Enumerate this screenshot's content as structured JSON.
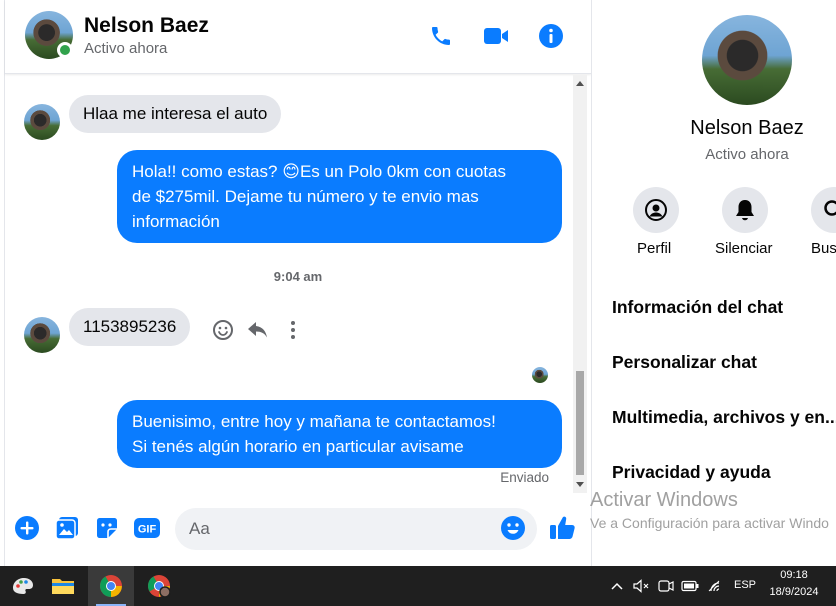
{
  "colors": {
    "accent": "#0a7cff",
    "online": "#31a24c",
    "incoming_bubble": "#e4e6eb",
    "outgoing_bubble": "#0a7cff"
  },
  "header": {
    "name": "Nelson Baez",
    "status": "Activo ahora",
    "icons": [
      "phone-icon",
      "video-icon",
      "info-icon"
    ]
  },
  "messages": [
    {
      "direction": "in",
      "text": "Hlaa me interesa  el auto"
    },
    {
      "direction": "out",
      "lines": [
        "Hola!! como estas? 😊Es un Polo 0km con cuotas",
        "de $275mil. Dejame tu número y te envio mas",
        "información"
      ]
    },
    {
      "direction": "time",
      "text": "9:04 am"
    },
    {
      "direction": "in",
      "text": "1153895236"
    },
    {
      "direction": "out",
      "lines": [
        "Buenisimo, entre hoy y mañana te contactamos!",
        "Si tenés algún horario en particular avisame"
      ]
    }
  ],
  "sent_label": "Enviado",
  "composer": {
    "placeholder": "Aa",
    "value": ""
  },
  "info": {
    "name": "Nelson Baez",
    "status": "Activo ahora",
    "actions": [
      {
        "label": "Perfil",
        "icon": "profile-icon"
      },
      {
        "label": "Silenciar",
        "icon": "bell-icon"
      },
      {
        "label": "Bus",
        "icon": "search-icon"
      }
    ],
    "items": [
      "Información del chat",
      "Personalizar chat",
      "Multimedia, archivos y en...",
      "Privacidad y ayuda"
    ]
  },
  "watermark": {
    "title": "Activar Windows",
    "subtitle": "Ve a Configuración para activar Windo"
  },
  "taskbar": {
    "apps": [
      "paint-icon",
      "file-explorer-icon",
      "chrome-icon",
      "chrome-profile-icon"
    ],
    "language": "ESP",
    "time": "09:18",
    "date": "18/9/2024"
  }
}
